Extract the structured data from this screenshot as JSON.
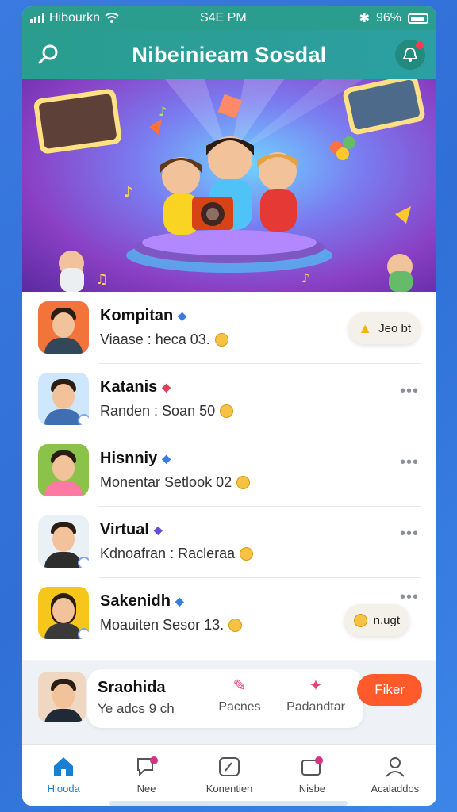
{
  "status_bar": {
    "carrier": "Hibourkn",
    "time": "S4E PM",
    "battery": "96%"
  },
  "header": {
    "title": "Nibeinieam Sosdal",
    "search_icon": "search-icon",
    "notification_icon": "notification-icon"
  },
  "feed": [
    {
      "name": "Kompitan",
      "subtitle": "Viaase : heca 03.",
      "verified_color": "#3a7be0",
      "chip": "Jeo bt",
      "avatar_bg": "#f2743b"
    },
    {
      "name": "Katanis",
      "subtitle": "Randen : Soan 50",
      "verified_color": "#e0415a",
      "more": "•••",
      "avatar_bg": "#cfe6ff"
    },
    {
      "name": "Hisnniy",
      "subtitle": "Monentar Setlook 02",
      "verified_color": "#3a7be0",
      "more": "•••",
      "avatar_bg": "#8bc34a"
    },
    {
      "name": "Virtual",
      "subtitle": "Kdnoafran : Racleraa",
      "verified_color": "#6a4fd6",
      "more": "•••",
      "avatar_bg": "#e9f1f7"
    },
    {
      "name": "Sakenidh",
      "subtitle": "Moauiten Sesor 13.",
      "verified_color": "#3a7be0",
      "more": "•••",
      "chip": "n.ugt",
      "avatar_bg": "#f7c61a"
    }
  ],
  "mini_bar": {
    "name": "Sraohida",
    "subtitle": "Ye adcs 9 ch",
    "action1": "Pacnes",
    "action2": "Padandtar",
    "cta": "Fiker"
  },
  "bottom_nav": [
    {
      "label": "Hlooda",
      "icon": "home-icon",
      "active": true
    },
    {
      "label": "Nee",
      "icon": "chat-icon",
      "active": false
    },
    {
      "label": "Konentien",
      "icon": "compose-icon",
      "active": false
    },
    {
      "label": "Nisbe",
      "icon": "inbox-icon",
      "active": false
    },
    {
      "label": "Acaladdos",
      "icon": "profile-icon",
      "active": false
    }
  ],
  "colors": {
    "accent": "#2a9d8f",
    "cta": "#ff5a2b",
    "active_tab": "#1b7fd1"
  }
}
